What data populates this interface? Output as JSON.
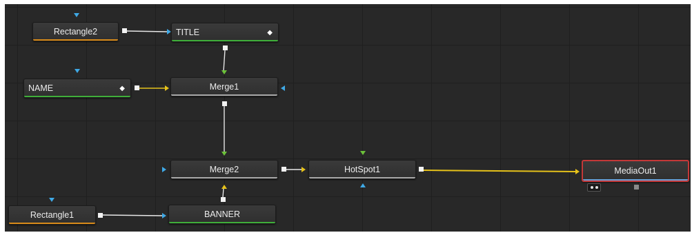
{
  "nodes": {
    "rectangle2": "Rectangle2",
    "title": "TITLE",
    "name": "NAME",
    "merge1": "Merge1",
    "merge2": "Merge2",
    "hotspot1": "HotSpot1",
    "mediaout1": "MediaOut1",
    "rectangle1": "Rectangle1",
    "banner": "BANNER"
  },
  "colors": {
    "canvas": "#282828",
    "wire_white": "#e8e8e8",
    "wire_yellow": "#e6c21a",
    "input_blue": "#3fa9e6",
    "input_green": "#6cc13a",
    "input_yellow": "#e6c21a",
    "selected_border": "#c43838"
  },
  "icons": {
    "text_node_icon": "diamond-icon"
  }
}
